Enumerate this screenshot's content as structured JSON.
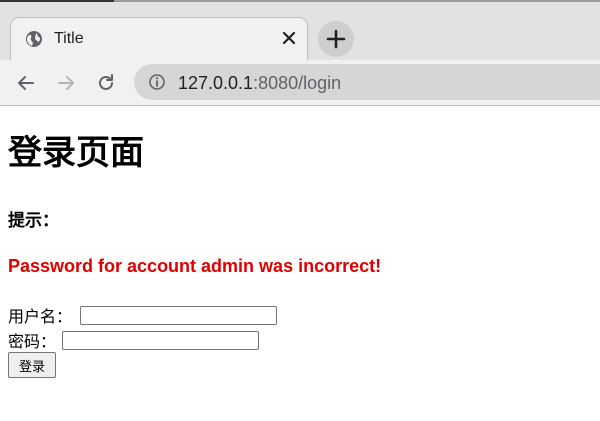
{
  "browser": {
    "tab": {
      "title": "Title"
    },
    "address": {
      "host": "127.0.0.1",
      "port": ":8080",
      "path": "/login"
    }
  },
  "page": {
    "heading": "登录页面",
    "hint_label": "提示：",
    "error_message": "Password for account admin was incorrect!",
    "form": {
      "username_label": "用户名：",
      "username_value": "",
      "password_label": "密码：",
      "password_value": "",
      "submit_label": "登录"
    }
  },
  "colors": {
    "error": "#e00000",
    "chrome_bg": "#e2e2e2"
  }
}
